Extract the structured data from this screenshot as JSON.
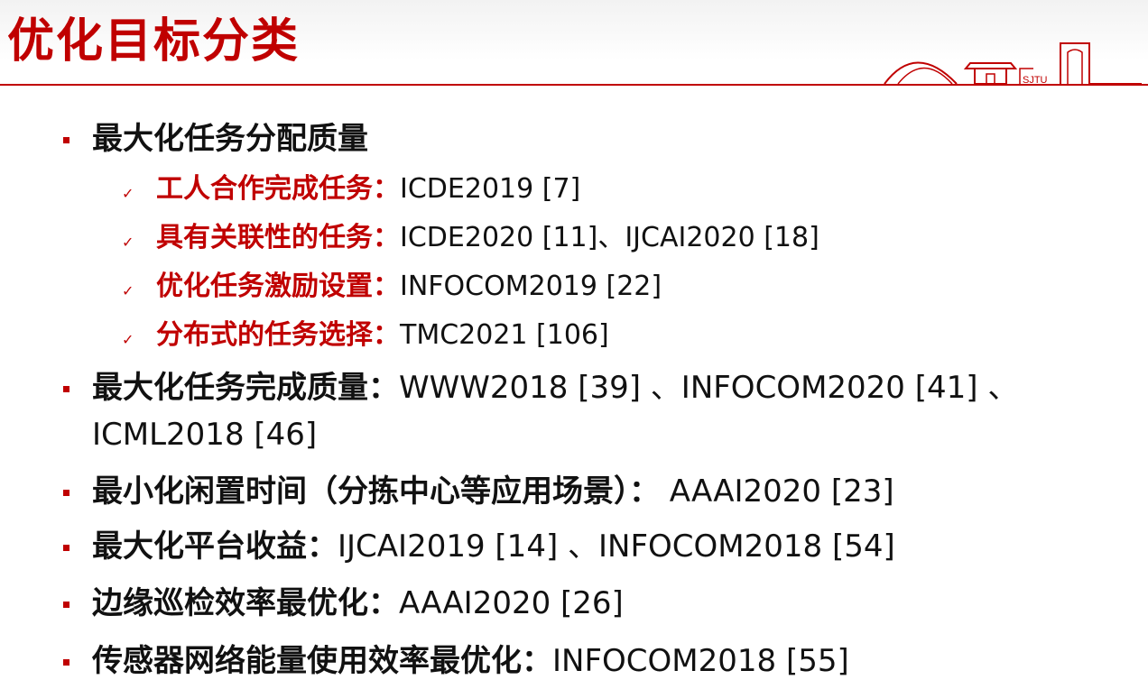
{
  "title": "优化目标分类",
  "logo_text": "SJTU",
  "items": [
    {
      "label": "最大化任务分配质量",
      "refs": ""
    },
    {
      "label": "最大化任务完成质量：",
      "refs": "WWW2018 [39] 、INFOCOM2020 [41] 、",
      "refs2": "ICML2018 [46]"
    },
    {
      "label": "最小化闲置时间（分拣中心等应用场景）：",
      "refs": " AAAI2020 [23]"
    },
    {
      "label": "最大化平台收益：",
      "refs": "IJCAI2019 [14] 、INFOCOM2018 [54]"
    },
    {
      "label": "边缘巡检效率最优化：",
      "refs": "AAAI2020 [26]"
    },
    {
      "label": "传感器网络能量使用效率最优化：",
      "refs": "INFOCOM2018 [55]"
    }
  ],
  "subitems": [
    {
      "label": "工人合作完成任务：",
      "refs": "ICDE2019 [7]"
    },
    {
      "label": "具有关联性的任务：",
      "refs": "ICDE2020 [11]、IJCAI2020 [18]"
    },
    {
      "label": "优化任务激励设置：",
      "refs": "INFOCOM2019 [22]"
    },
    {
      "label": "分布式的任务选择：",
      "refs": "TMC2021 [106]"
    }
  ],
  "colors": {
    "accent": "#c00000",
    "text": "#111111"
  },
  "check_icon": "✓"
}
